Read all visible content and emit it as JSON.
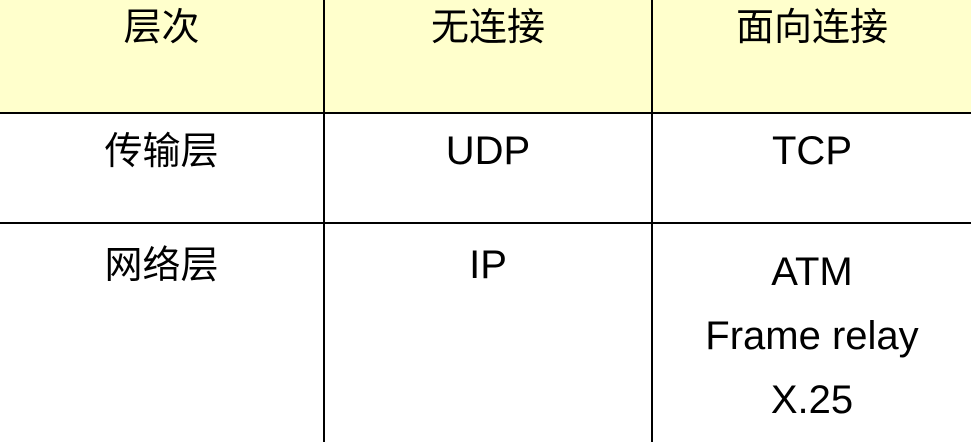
{
  "table": {
    "headers": [
      "层次",
      "无连接",
      "面向连接"
    ],
    "rows": [
      {
        "layer": "传输层",
        "connectionless": [
          "UDP"
        ],
        "connection_oriented": [
          "TCP"
        ]
      },
      {
        "layer": "网络层",
        "connectionless": [
          "IP"
        ],
        "connection_oriented": [
          "ATM",
          "Frame relay",
          "X.25"
        ]
      }
    ]
  },
  "colors": {
    "header_background": "#ffffcc",
    "grid_lines": "#000000",
    "text": "#000000",
    "body_background": "#ffffff"
  }
}
